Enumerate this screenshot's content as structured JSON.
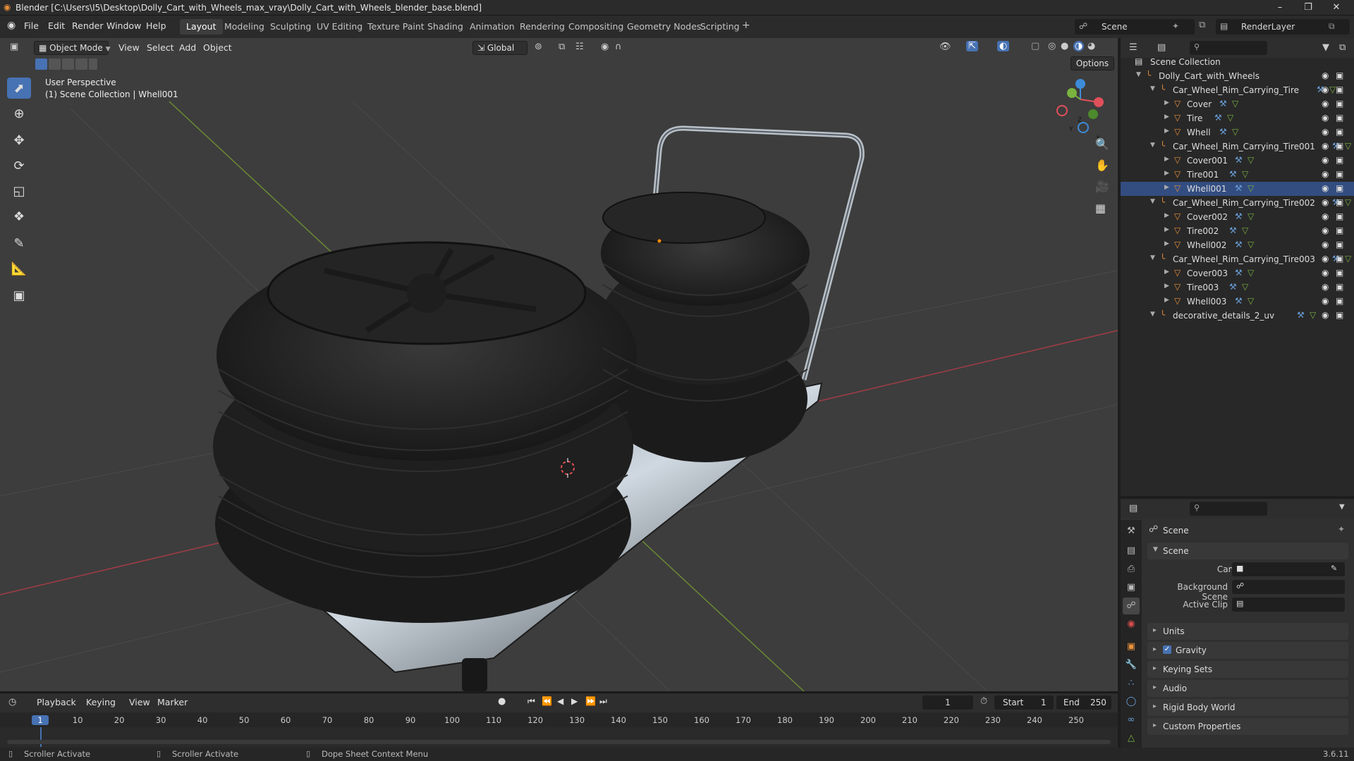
{
  "titlebar": {
    "title": "Blender [C:\\Users\\I5\\Desktop\\Dolly_Cart_with_Wheels_max_vray\\Dolly_Cart_with_Wheels_blender_base.blend]",
    "minimize": "–",
    "restore": "❐",
    "close": "✕"
  },
  "menu": {
    "items": [
      "File",
      "Edit",
      "Render",
      "Window",
      "Help"
    ]
  },
  "workspaces": [
    "Layout",
    "Modeling",
    "Sculpting",
    "UV Editing",
    "Texture Paint",
    "Shading",
    "Animation",
    "Rendering",
    "Compositing",
    "Geometry Nodes",
    "Scripting"
  ],
  "workspace_add": "+",
  "scene_selector": {
    "scene": "Scene",
    "view_layer": "RenderLayer"
  },
  "viewport": {
    "mode": "Object Mode",
    "menus": [
      "View",
      "Select",
      "Add",
      "Object"
    ],
    "transform_orientation": "Global",
    "options_label": "Options",
    "perspective_label": "User Perspective",
    "collection_label": "(1) Scene Collection | Whell001",
    "gizmo_axes": {
      "x": "X",
      "y": "Y",
      "z": "Z"
    }
  },
  "outliner": {
    "root": "Scene Collection",
    "rows": [
      {
        "name": "Dolly_Cart_with_Wheels",
        "level": 0
      },
      {
        "name": "Car_Wheel_Rim_Carrying_Tire",
        "level": 1
      },
      {
        "name": "Cover",
        "level": 2
      },
      {
        "name": "Tire",
        "level": 2
      },
      {
        "name": "Whell",
        "level": 2
      },
      {
        "name": "Car_Wheel_Rim_Carrying_Tire001",
        "level": 1
      },
      {
        "name": "Cover001",
        "level": 2
      },
      {
        "name": "Tire001",
        "level": 2
      },
      {
        "name": "Whell001",
        "level": 2
      },
      {
        "name": "Car_Wheel_Rim_Carrying_Tire002",
        "level": 1
      },
      {
        "name": "Cover002",
        "level": 2
      },
      {
        "name": "Tire002",
        "level": 2
      },
      {
        "name": "Whell002",
        "level": 2
      },
      {
        "name": "Car_Wheel_Rim_Carrying_Tire003",
        "level": 1
      },
      {
        "name": "Cover003",
        "level": 2
      },
      {
        "name": "Tire003",
        "level": 2
      },
      {
        "name": "Whell003",
        "level": 2
      },
      {
        "name": "decorative_details_2_uv",
        "level": 1
      }
    ]
  },
  "properties": {
    "context": "Scene",
    "panel_title": "Scene",
    "fields": {
      "camera": "Camera",
      "background_scene": "Background Scene",
      "active_clip": "Active Clip"
    },
    "sections": [
      "Units",
      "Gravity",
      "Keying Sets",
      "Audio",
      "Rigid Body World",
      "Custom Properties"
    ],
    "gravity_checked": true
  },
  "timeline": {
    "menus": [
      "Playback",
      "Keying",
      "View",
      "Marker"
    ],
    "current_frame": "1",
    "start_label": "Start",
    "start": "1",
    "end_label": "End",
    "end": "250",
    "ticks": [
      "1",
      "10",
      "20",
      "30",
      "40",
      "50",
      "60",
      "70",
      "80",
      "90",
      "100",
      "110",
      "120",
      "130",
      "140",
      "150",
      "160",
      "170",
      "180",
      "190",
      "200",
      "210",
      "220",
      "230",
      "240",
      "250"
    ]
  },
  "statusbar": {
    "items": [
      "Scroller Activate",
      "Scroller Activate",
      "Dope Sheet Context Menu"
    ],
    "version": "3.6.11"
  },
  "colors": {
    "accent": "#4772b3",
    "x_axis": "#e0505a",
    "y_axis": "#7ab340",
    "z_axis": "#3d8bd9",
    "mesh_icon": "#e8903a"
  }
}
